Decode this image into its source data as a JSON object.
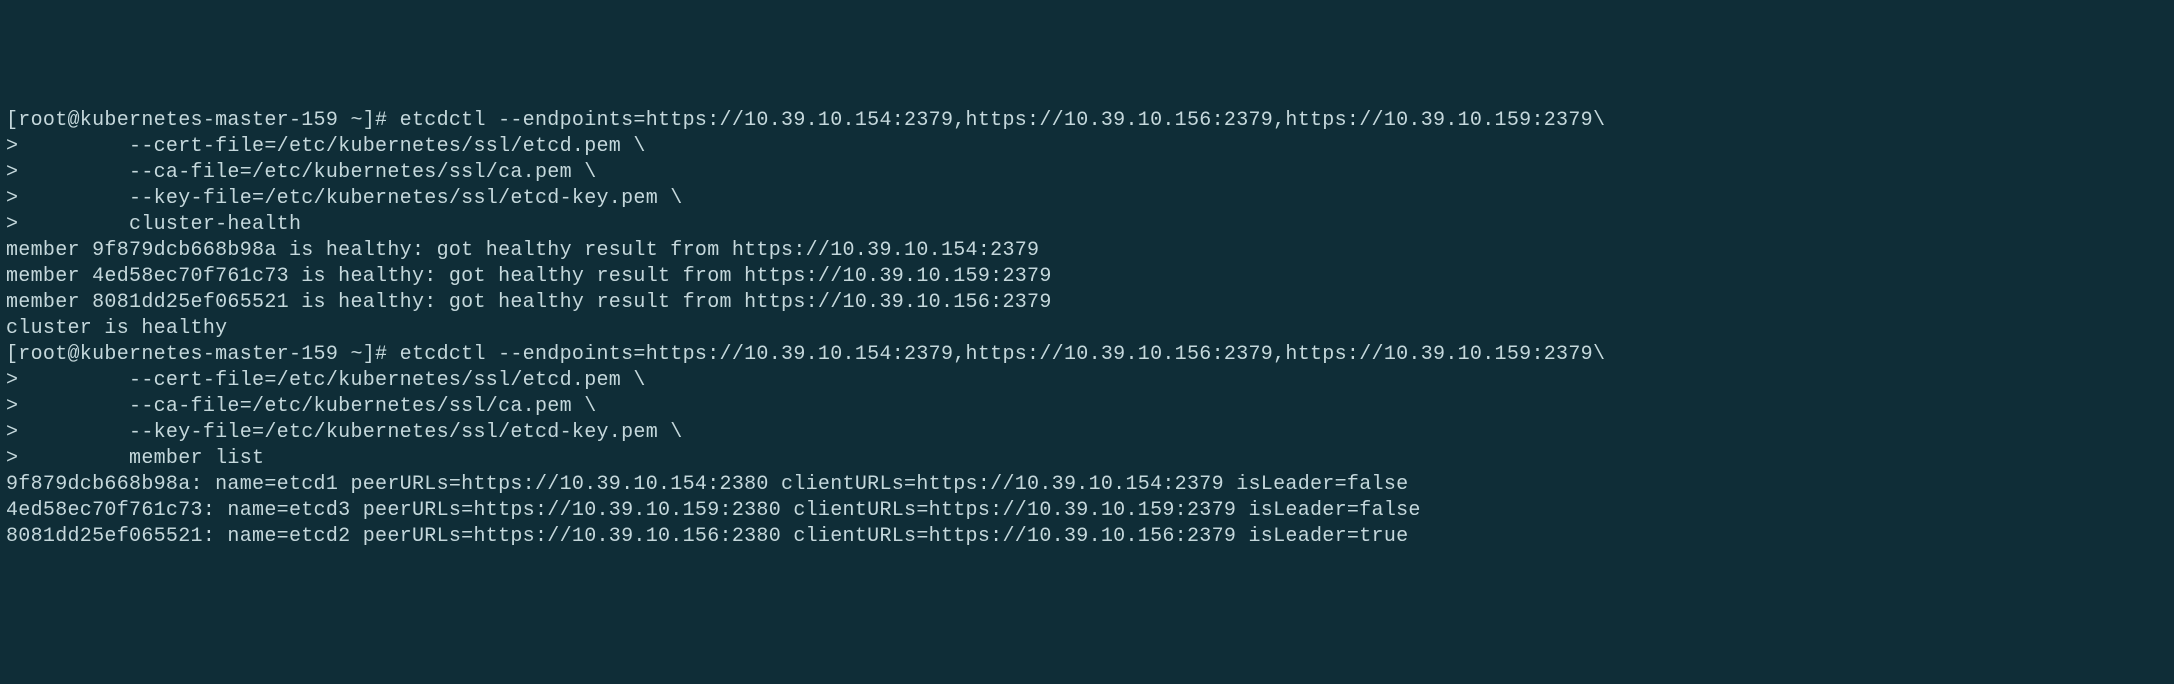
{
  "lines": {
    "l1": "[root@kubernetes-master-159 ~]# etcdctl --endpoints=https://10.39.10.154:2379,https://10.39.10.156:2379,https://10.39.10.159:2379\\",
    "l2": ">         --cert-file=/etc/kubernetes/ssl/etcd.pem \\",
    "l3": ">         --ca-file=/etc/kubernetes/ssl/ca.pem \\",
    "l4": ">         --key-file=/etc/kubernetes/ssl/etcd-key.pem \\",
    "l5": ">         cluster-health",
    "l6": "member 9f879dcb668b98a is healthy: got healthy result from https://10.39.10.154:2379",
    "l7": "member 4ed58ec70f761c73 is healthy: got healthy result from https://10.39.10.159:2379",
    "l8": "member 8081dd25ef065521 is healthy: got healthy result from https://10.39.10.156:2379",
    "l9": "cluster is healthy",
    "l10": "[root@kubernetes-master-159 ~]# etcdctl --endpoints=https://10.39.10.154:2379,https://10.39.10.156:2379,https://10.39.10.159:2379\\",
    "l11": ">         --cert-file=/etc/kubernetes/ssl/etcd.pem \\",
    "l12": ">         --ca-file=/etc/kubernetes/ssl/ca.pem \\",
    "l13": ">         --key-file=/etc/kubernetes/ssl/etcd-key.pem \\",
    "l14": ">         member list",
    "l15": "9f879dcb668b98a: name=etcd1 peerURLs=https://10.39.10.154:2380 clientURLs=https://10.39.10.154:2379 isLeader=false",
    "l16": "4ed58ec70f761c73: name=etcd3 peerURLs=https://10.39.10.159:2380 clientURLs=https://10.39.10.159:2379 isLeader=false",
    "l17": "8081dd25ef065521: name=etcd2 peerURLs=https://10.39.10.156:2380 clientURLs=https://10.39.10.156:2379 isLeader=true"
  }
}
